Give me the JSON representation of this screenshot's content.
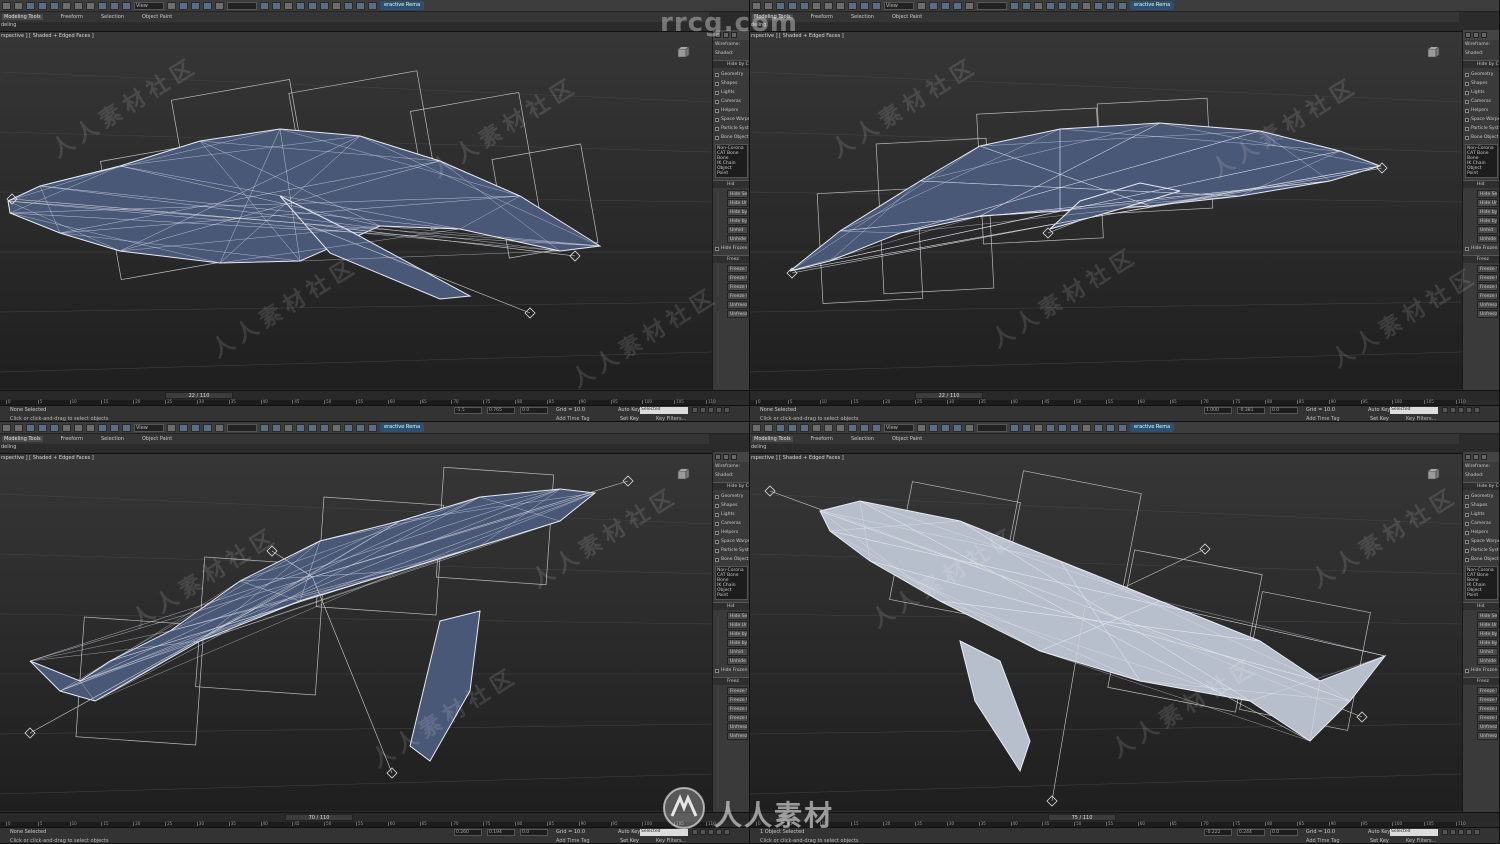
{
  "toolbar": {
    "interactive_label": "eractive Rema",
    "view_dropdown": "View",
    "selection_set_placeholder": ""
  },
  "ribbon": {
    "tabs": [
      "Modeling Tools",
      "Freeform",
      "Selection",
      "Object Paint"
    ],
    "sub_label": "deling"
  },
  "viewport": {
    "label": "rspective ] [ Shaded + Edged Faces ]"
  },
  "command_panel": {
    "display_rows": [
      "Wireframe:",
      "Shaded:"
    ],
    "hide_by_category_title": "Hide by C",
    "categories": [
      "Geometry",
      "Shapes",
      "Lights",
      "Cameras",
      "Helpers",
      "Space Warps",
      "Particle Syst",
      "Bone Object"
    ],
    "list_items": [
      "Non-Corona",
      "CAT Bone",
      "Bone",
      "IK Chain Object",
      "Point"
    ],
    "hide_title": "Hid",
    "hide_buttons": [
      "Hide Sel",
      "Hide Unse",
      "Hide by N",
      "Hide by H",
      "Unhid",
      "Unhide by"
    ],
    "hide_frozen": "Hide Frozen",
    "freeze_title": "Freez",
    "freeze_buttons": [
      "Freeze S",
      "Freeze Uns",
      "Freeze by",
      "Freeze b",
      "Unfreez",
      "Unfreeze b"
    ]
  },
  "quadrants": [
    {
      "frame_counter": "22 / 110",
      "status_selection": "None Selected",
      "status_prompt": "Click or click-and-drag to select objects",
      "coords": {
        "x": "-1.5",
        "y": "0.765",
        "z": "0.0"
      }
    },
    {
      "frame_counter": "22 / 110",
      "status_selection": "None Selected",
      "status_prompt": "Click or click-and-drag to select objects",
      "coords": {
        "x": "1.000",
        "y": "-0.381",
        "z": "0.0"
      }
    },
    {
      "frame_counter": "70 / 110",
      "status_selection": "None Selected",
      "status_prompt": "Click or click-and-drag to select objects",
      "coords": {
        "x": "0.260",
        "y": "0.194",
        "z": "0.0"
      }
    },
    {
      "frame_counter": "75 / 110",
      "status_selection": "1 Object Selected",
      "status_prompt": "Click or click-and-drag to select objects",
      "coords": {
        "x": "-0.222",
        "y": "0.244",
        "z": "0.0"
      }
    }
  ],
  "status": {
    "grid": "Grid = 10.0",
    "add_time_tag": "Add Time Tag",
    "auto_key": "Auto Key",
    "set_key": "Set Key",
    "selected": "Selected",
    "key_filters": "Key Filters..."
  },
  "timeline": {
    "ticks": [
      "0",
      "5",
      "10",
      "15",
      "20",
      "25",
      "30",
      "35",
      "40",
      "45",
      "50",
      "55",
      "60",
      "65",
      "70",
      "75",
      "80",
      "85",
      "90",
      "95",
      "100",
      "105",
      "110"
    ]
  },
  "watermark": {
    "repeated": "人人素材社区",
    "domain": "rrcg.com",
    "brand": "人人素材"
  },
  "colors": {
    "viewport_top": "#363636",
    "viewport_bottom": "#1f1f1f",
    "whale_body": "#4a5878",
    "wire": "#e8ecf4",
    "accent": "#2d4f73"
  }
}
